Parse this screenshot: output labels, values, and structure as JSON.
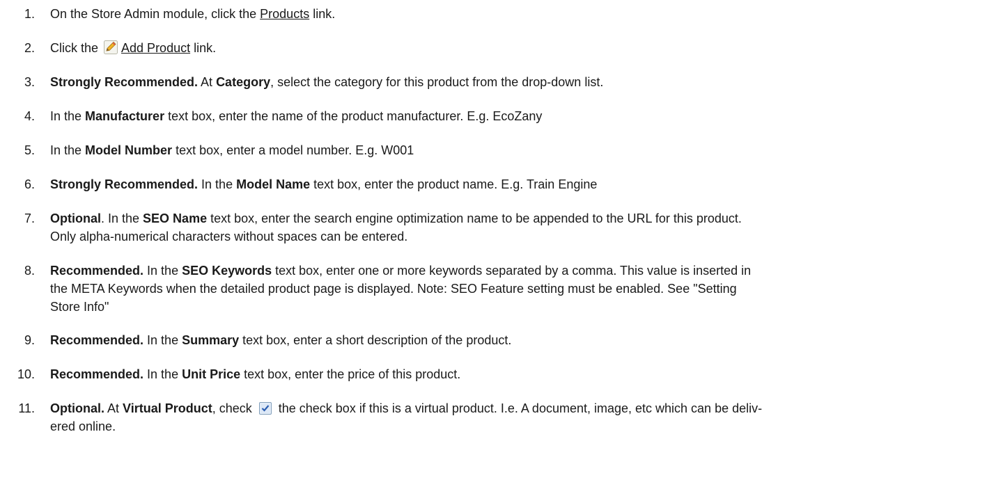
{
  "steps": [
    {
      "num": "1.",
      "t1": "On the Store Admin module, click the ",
      "link": "Products",
      "t2": " link."
    },
    {
      "num": "2.",
      "t1": "Click the ",
      "link": "Add Product",
      "t2": " link.",
      "icon": "edit-pencil-icon"
    },
    {
      "num": "3.",
      "b1": "Strongly Recommended.",
      "t1": " At ",
      "b2": "Category",
      "t2": ", select the category for this product from the drop-down list."
    },
    {
      "num": "4.",
      "t1": "In the ",
      "b1": "Manufacturer",
      "t2": " text box, enter the name of the product manufacturer. E.g. EcoZany"
    },
    {
      "num": "5.",
      "t1": "In the ",
      "b1": "Model Number",
      "t2": " text box, enter a model number. E.g. W001"
    },
    {
      "num": "6.",
      "b1": "Strongly Recommended.",
      "t1": " In the ",
      "b2": "Model Name",
      "t2": " text box, enter the product name. E.g. Train Engine"
    },
    {
      "num": "7.",
      "b1": "Optional",
      "t1": ". In the ",
      "b2": "SEO Name",
      "t2": " text box, enter the search engine optimization name to be appended to the URL for this product.",
      "l2": "Only alpha-numerical characters without spaces can be entered."
    },
    {
      "num": "8.",
      "b1": "Recommended.",
      "t1": " In the ",
      "b2": "SEO Keywords",
      "t2": " text box, enter one or more keywords separated by a comma. This value is inserted in",
      "l2": "the META Keywords when the detailed product page is displayed. Note: SEO Feature setting must be enabled. See \"Setting",
      "l3": "Store Info\""
    },
    {
      "num": "9.",
      "b1": "Recommended.",
      "t1": " In the ",
      "b2": "Summary",
      "t2": " text box, enter a short description of the product."
    },
    {
      "num": "10.",
      "b1": "Recommended.",
      "t1": " In the ",
      "b2": "Unit Price",
      "t2": " text box, enter the price of this product."
    },
    {
      "num": "11.",
      "b1": "Optional.",
      "t1": " At ",
      "b2": "Virtual Product",
      "t2": ", check ",
      "icon": "checked-checkbox-icon",
      "t3": " the check box if this is a virtual product. I.e. A document, image, etc which can be deliv-",
      "l2": "ered online."
    }
  ]
}
